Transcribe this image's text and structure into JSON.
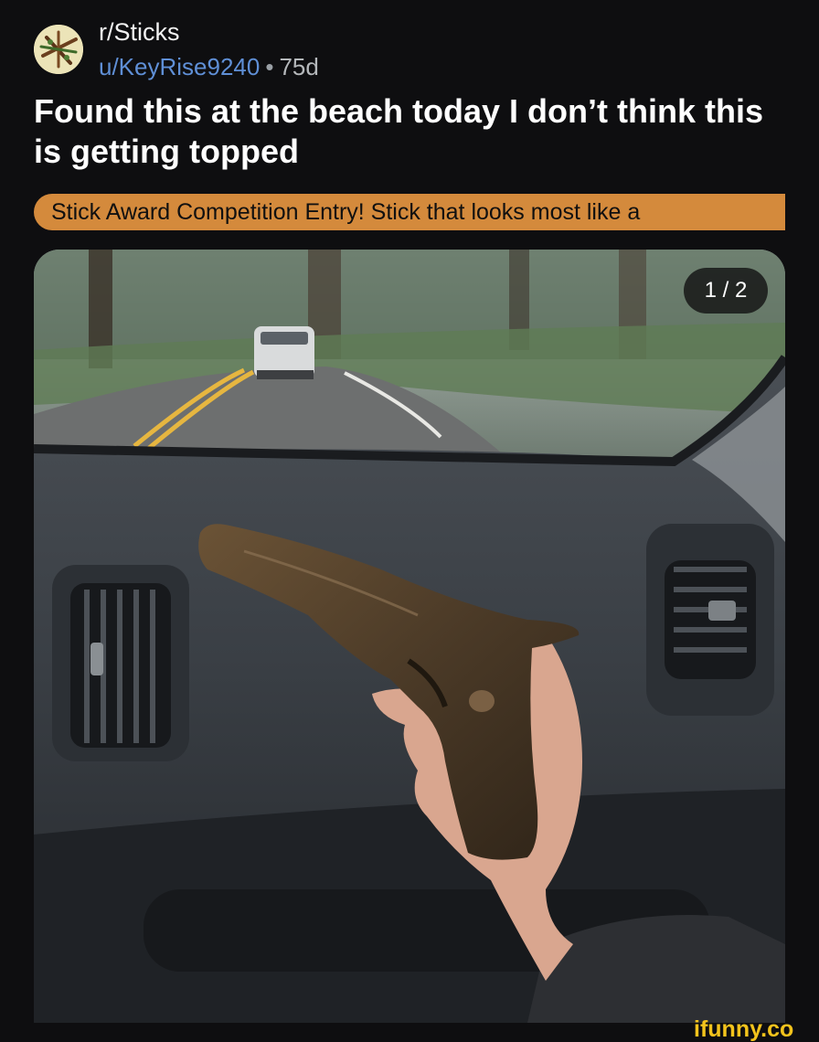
{
  "post": {
    "subreddit": "r/Sticks",
    "username": "u/KeyRise9240",
    "separator": "•",
    "age": "75d",
    "title": "Found this at the beach today I don’t think this is getting topped",
    "flair": "Stick Award Competition Entry! Stick that looks most like a"
  },
  "media": {
    "counter": "1 / 2",
    "description_icon": "photo-icon"
  },
  "watermark": "ifunny.co",
  "colors": {
    "background": "#0e0e10",
    "flair": "#d48a3c",
    "username": "#5f8fd6",
    "watermark": "#f3c31c"
  }
}
